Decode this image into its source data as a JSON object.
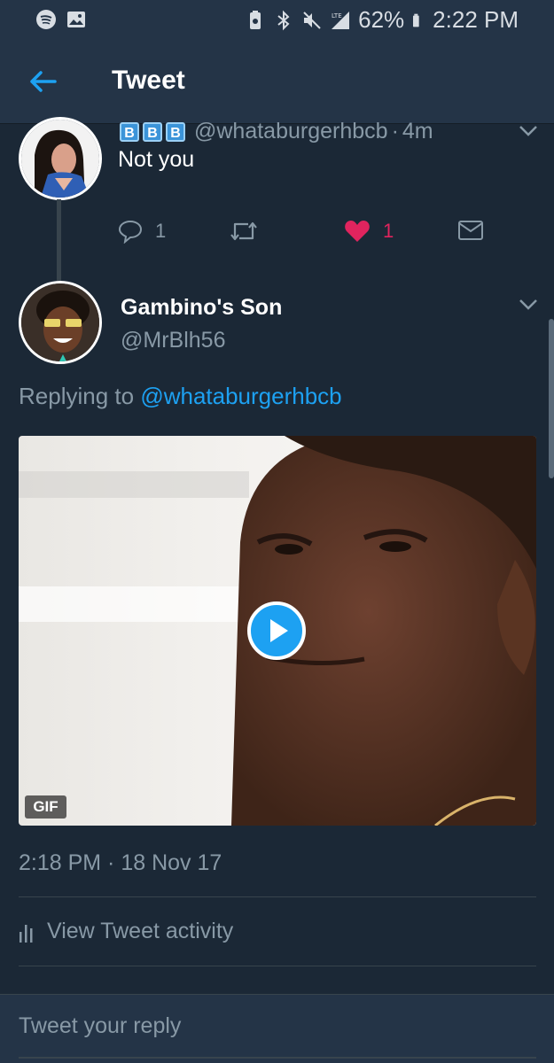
{
  "status_bar": {
    "battery": "62%",
    "time": "2:22 PM",
    "icons": [
      "spotify-icon",
      "image-icon",
      "battery-saver-icon",
      "bluetooth-icon",
      "mute-icon",
      "lte-signal-icon",
      "battery-icon"
    ]
  },
  "header": {
    "title": "Tweet",
    "back_icon": "back-arrow-icon"
  },
  "previous_tweet": {
    "badges": [
      "B",
      "B",
      "B"
    ],
    "handle": "@whataburgerhbcb",
    "time": "4m",
    "text": "Not you",
    "reply_count": "1",
    "like_count": "1"
  },
  "tweet": {
    "author_name": "Gambino's Son",
    "author_handle": "@MrBlh56",
    "replying_prefix": "Replying to",
    "replying_handle": "@whataburgerhbcb",
    "media_badge": "GIF",
    "timestamp": "2:18 PM · 18 Nov 17",
    "activity_label": "View Tweet activity"
  },
  "reply": {
    "placeholder": "Tweet your reply"
  },
  "colors": {
    "background": "#1b2836",
    "bar": "#243447",
    "accent": "#1da1f2",
    "like": "#e0245e",
    "muted": "#8899a6"
  }
}
